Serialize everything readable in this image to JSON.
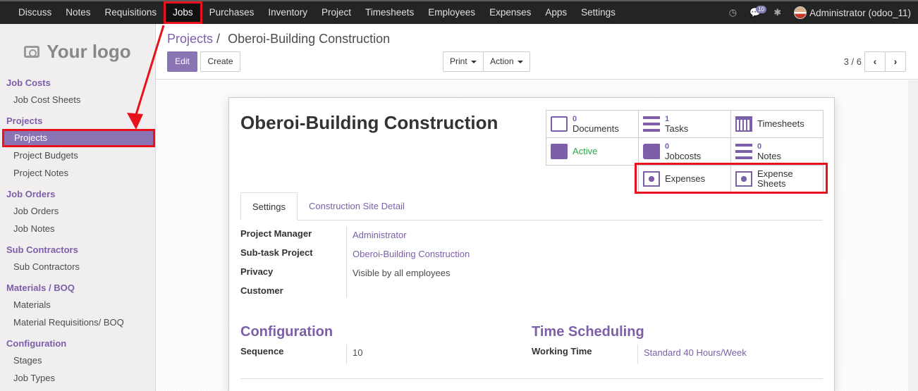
{
  "topbar": {
    "menu": [
      "Discuss",
      "Notes",
      "Requisitions",
      "Jobs",
      "Purchases",
      "Inventory",
      "Project",
      "Timesheets",
      "Employees",
      "Expenses",
      "Apps",
      "Settings"
    ],
    "active": "Jobs",
    "message_count": "10",
    "user": "Administrator (odoo_11)"
  },
  "sidebar": {
    "logo_text": "Your logo",
    "sections": [
      {
        "title": "Job Costs",
        "items": [
          "Job Cost Sheets"
        ]
      },
      {
        "title": "Projects",
        "items": [
          "Projects",
          "Project Budgets",
          "Project Notes"
        ]
      },
      {
        "title": "Job Orders",
        "items": [
          "Job Orders",
          "Job Notes"
        ]
      },
      {
        "title": "Sub Contractors",
        "items": [
          "Sub Contractors"
        ]
      },
      {
        "title": "Materials / BOQ",
        "items": [
          "Materials",
          "Material Requisitions/ BOQ"
        ]
      },
      {
        "title": "Configuration",
        "items": [
          "Stages",
          "Job Types"
        ]
      }
    ],
    "active_item": "Projects"
  },
  "control": {
    "breadcrumb_parent": "Projects",
    "breadcrumb_sep": "/",
    "breadcrumb_current": "Oberoi-Building Construction",
    "edit_label": "Edit",
    "create_label": "Create",
    "print_label": "Print",
    "action_label": "Action",
    "pager": "3 / 6"
  },
  "form": {
    "title": "Oberoi-Building Construction",
    "smart_buttons": {
      "documents": {
        "count": "0",
        "label": "Documents"
      },
      "tasks": {
        "count": "1",
        "label": "Tasks"
      },
      "timesheets": {
        "label": "Timesheets"
      },
      "active": {
        "label": "Active"
      },
      "jobcosts": {
        "count": "0",
        "label": "Jobcosts"
      },
      "notes": {
        "count": "0",
        "label": "Notes"
      },
      "expenses": {
        "label": "Expenses"
      },
      "expense_sheets": {
        "label1": "Expense",
        "label2": "Sheets"
      }
    },
    "tabs": [
      "Settings",
      "Construction Site Detail"
    ],
    "fields": {
      "project_manager_label": "Project Manager",
      "project_manager": "Administrator",
      "subtask_label": "Sub-task Project",
      "subtask": "Oberoi-Building Construction",
      "privacy_label": "Privacy",
      "privacy": "Visible by all employees",
      "customer_label": "Customer"
    },
    "configuration": {
      "title": "Configuration",
      "sequence_label": "Sequence",
      "sequence": "10"
    },
    "scheduling": {
      "title": "Time Scheduling",
      "working_time_label": "Working Time",
      "working_time": "Standard 40 Hours/Week"
    }
  },
  "colors": {
    "accent": "#7c5fa8",
    "highlight": "#e8121c",
    "topbar": "#242424",
    "active_status": "#28a745"
  }
}
